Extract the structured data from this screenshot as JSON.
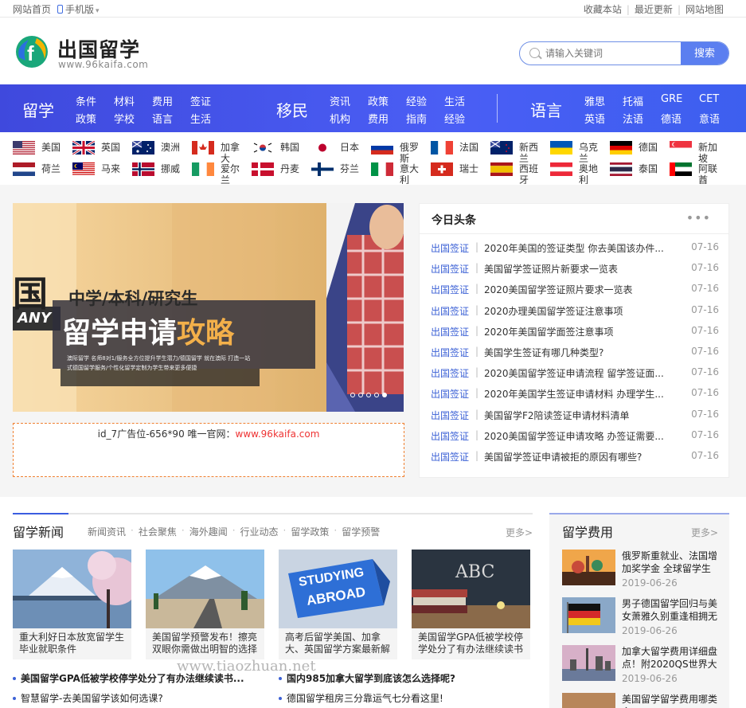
{
  "topbar": {
    "home": "网站首页",
    "mobile": "手机版",
    "bookmark": "收藏本站",
    "latest": "最近更新",
    "sitemap": "网站地图"
  },
  "brand": {
    "name": "出国留学",
    "url": "www.96kaifa.com"
  },
  "search": {
    "placeholder": "请输入关键词",
    "button": "搜索"
  },
  "nav": {
    "study": {
      "title": "留学",
      "links": [
        [
          "条件",
          "政策"
        ],
        [
          "材料",
          "学校"
        ],
        [
          "费用",
          "语言"
        ],
        [
          "签证",
          "生活"
        ]
      ]
    },
    "immigrate": {
      "title": "移民",
      "links": [
        [
          "资讯",
          "机构"
        ],
        [
          "政策",
          "费用"
        ],
        [
          "经验",
          "指南"
        ],
        [
          "生活",
          "经验"
        ]
      ]
    },
    "language": {
      "title": "语言",
      "links": [
        [
          "雅思",
          "英语"
        ],
        [
          "托福",
          "法语"
        ],
        [
          "GRE",
          "德语"
        ],
        [
          "CET",
          "意语"
        ]
      ]
    }
  },
  "flags": [
    {
      "name": "美国",
      "code": "us"
    },
    {
      "name": "英国",
      "code": "uk"
    },
    {
      "name": "澳洲",
      "code": "au"
    },
    {
      "name": "加拿大",
      "code": "ca"
    },
    {
      "name": "韩国",
      "code": "kr"
    },
    {
      "name": "日本",
      "code": "jp"
    },
    {
      "name": "俄罗斯",
      "code": "ru"
    },
    {
      "name": "法国",
      "code": "fr"
    },
    {
      "name": "新西兰",
      "code": "nz"
    },
    {
      "name": "乌克兰",
      "code": "ua"
    },
    {
      "name": "德国",
      "code": "de"
    },
    {
      "name": "新加坡",
      "code": "sg"
    },
    {
      "name": "荷兰",
      "code": "nl"
    },
    {
      "name": "马来",
      "code": "my"
    },
    {
      "name": "挪威",
      "code": "no"
    },
    {
      "name": "爱尔兰",
      "code": "ie"
    },
    {
      "name": "丹麦",
      "code": "dk"
    },
    {
      "name": "芬兰",
      "code": "fi"
    },
    {
      "name": "意大利",
      "code": "it"
    },
    {
      "name": "瑞士",
      "code": "ch"
    },
    {
      "name": "西班牙",
      "code": "es"
    },
    {
      "name": "奥地利",
      "code": "at"
    },
    {
      "name": "泰国",
      "code": "th"
    },
    {
      "name": "阿联酋",
      "code": "ae"
    }
  ],
  "banner": {
    "big_text": "国",
    "side_text": "ANY",
    "line1": "中学/本科/研究生",
    "line2a": "留学申请",
    "line2b": "攻略",
    "small1": "澳际留学 名师8对1/服务全方位提升学生潜力/德国留学 就在澳际 打造一站",
    "small2": "式德国留学服务/个性化留学定制为学生带来更多便捷"
  },
  "ad": {
    "text": "id_7广告位-656*90 唯一官网：",
    "url": "www.96kaifa.com"
  },
  "headlines": {
    "title": "今日头条",
    "more": "•••",
    "items": [
      {
        "cat": "出国签证",
        "title": "2020年美国的签证类型 你去美国该办件...",
        "date": "07-16"
      },
      {
        "cat": "出国签证",
        "title": "美国留学签证照片新要求一览表",
        "date": "07-16"
      },
      {
        "cat": "出国签证",
        "title": "2020美国留学签证照片要求一览表",
        "date": "07-16"
      },
      {
        "cat": "出国签证",
        "title": "2020办理美国留学签证注意事项",
        "date": "07-16"
      },
      {
        "cat": "出国签证",
        "title": "2020年美国留学面签注意事项",
        "date": "07-16"
      },
      {
        "cat": "出国签证",
        "title": "美国学生签证有哪几种类型?",
        "date": "07-16"
      },
      {
        "cat": "出国签证",
        "title": "2020美国留学签证申请流程 留学签证面...",
        "date": "07-16"
      },
      {
        "cat": "出国签证",
        "title": "2020年美国学生签证申请材料 办理学生...",
        "date": "07-16"
      },
      {
        "cat": "出国签证",
        "title": "美国留学F2陪读签证申请材料清单",
        "date": "07-16"
      },
      {
        "cat": "出国签证",
        "title": "2020美国留学签证申请攻略 办签证需要...",
        "date": "07-16"
      },
      {
        "cat": "出国签证",
        "title": "美国留学签证申请被拒的原因有哪些?",
        "date": "07-16"
      }
    ]
  },
  "news": {
    "title": "留学新闻",
    "tabs": [
      "新闻资讯",
      "社会聚焦",
      "海外趣闻",
      "行业动态",
      "留学政策",
      "留学预警"
    ],
    "more": "更多>",
    "cards": [
      {
        "caption": "重大利好日本放宽留学生毕业就职条件"
      },
      {
        "caption": "美国留学预警发布！擦亮双眼你需做出明智的选择"
      },
      {
        "caption": "高考后留学美国、加拿大、英国留学方案最新解"
      },
      {
        "caption": "美国留学GPA低被学校停学处分了有办法继续读书"
      }
    ],
    "card_art": {
      "studying": "STUDYING",
      "abroad": "ABROAD",
      "abc": "ABC"
    },
    "list": [
      "美国留学GPA低被学校停学处分了有办法继续读书...",
      "国内985加拿大留学到底该怎么选择呢?",
      "智慧留学-去美国留学该如何选课?",
      "德国留学租房三分靠运气七分看这里!"
    ]
  },
  "fees": {
    "title": "留学费用",
    "more": "更多>",
    "items": [
      {
        "title": "俄罗斯重就业、法国增加奖学金 全球留学生",
        "date": "2019-06-26"
      },
      {
        "title": "男子德国留学回归与美女萧雅久别重逢相拥无",
        "date": "2019-06-26"
      },
      {
        "title": "加拿大留学费用详细盘点！附2020QS世界大",
        "date": "2019-06-26"
      },
      {
        "title": "美国留学留学费用哪类主",
        "date": ""
      }
    ]
  },
  "watermark": "www.tiaozhuan.net",
  "colors": {
    "accent": "#4a5ef5",
    "link": "#3d62d6",
    "ad_border": "#f08030"
  }
}
